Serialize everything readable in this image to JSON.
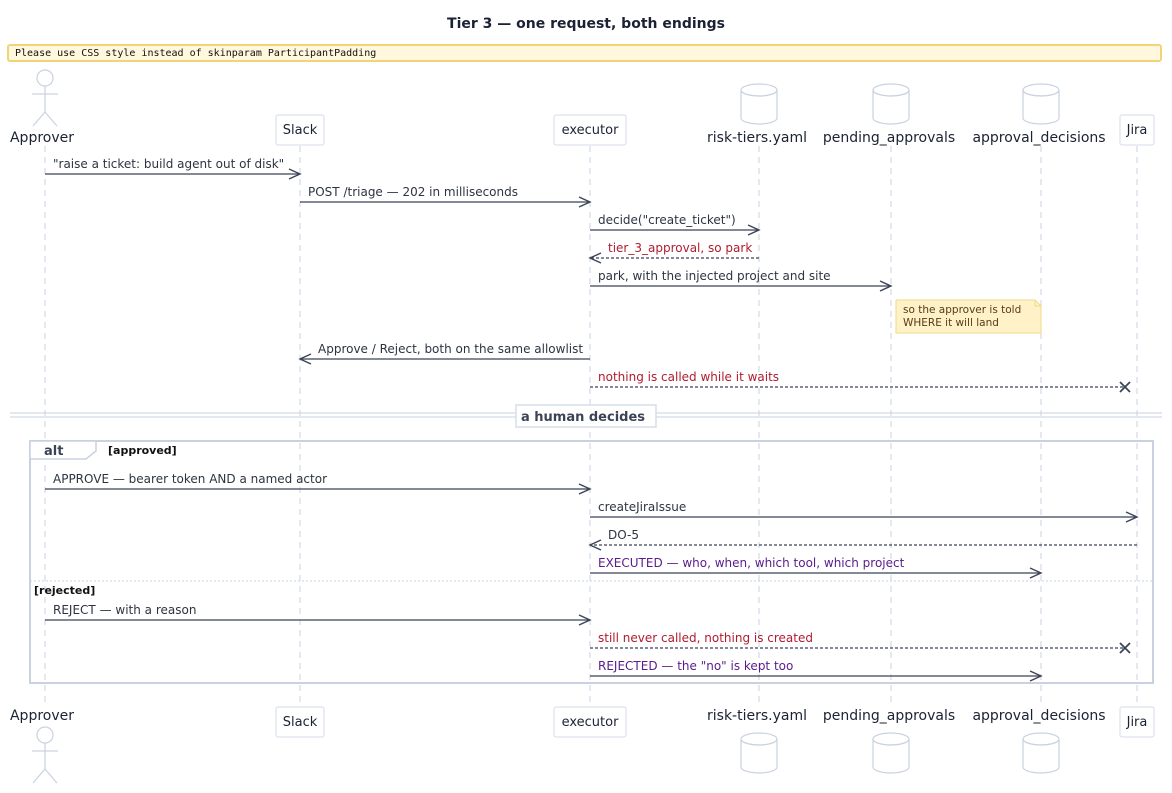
{
  "diagram": {
    "title": "Tier 3 — one request, both endings",
    "warning": "Please use CSS style instead of skinparam ParticipantPadding",
    "participants": [
      {
        "id": "approver",
        "label": "Approver",
        "kind": "actor"
      },
      {
        "id": "slack",
        "label": "Slack",
        "kind": "box"
      },
      {
        "id": "executor",
        "label": "executor",
        "kind": "box"
      },
      {
        "id": "risk",
        "label": "risk-tiers.yaml",
        "kind": "database"
      },
      {
        "id": "pending",
        "label": "pending_approvals",
        "kind": "database"
      },
      {
        "id": "decisions",
        "label": "approval_decisions",
        "kind": "database"
      },
      {
        "id": "jira",
        "label": "Jira",
        "kind": "box"
      }
    ],
    "messages": [
      {
        "from": "approver",
        "to": "slack",
        "label": "\"raise a ticket: build agent out of disk\"",
        "style": "solid",
        "color": "default"
      },
      {
        "from": "slack",
        "to": "executor",
        "label": "POST /triage — 202 in milliseconds",
        "style": "solid",
        "color": "default"
      },
      {
        "from": "executor",
        "to": "risk",
        "label": "decide(\"create_ticket\")",
        "style": "solid",
        "color": "default"
      },
      {
        "from": "risk",
        "to": "executor",
        "label": "tier_3_approval, so park",
        "style": "dashed",
        "color": "red"
      },
      {
        "from": "executor",
        "to": "pending",
        "label": "park, with the injected project and site",
        "style": "solid",
        "color": "default"
      },
      {
        "from": "executor",
        "to": "slack",
        "label": "Approve / Reject, both on the same allowlist",
        "style": "solid",
        "color": "default"
      },
      {
        "from": "executor",
        "to": "jira",
        "label": "nothing is called while it waits",
        "style": "lost",
        "color": "red"
      },
      {
        "from": "approver",
        "to": "executor",
        "label": "APPROVE — bearer token AND a named actor",
        "style": "solid",
        "color": "default"
      },
      {
        "from": "executor",
        "to": "jira",
        "label": "createJiraIssue",
        "style": "solid",
        "color": "default"
      },
      {
        "from": "jira",
        "to": "executor",
        "label": "DO-5",
        "style": "dashed",
        "color": "default"
      },
      {
        "from": "executor",
        "to": "decisions",
        "label": "EXECUTED — who, when, which tool, which project",
        "style": "solid",
        "color": "purple"
      },
      {
        "from": "approver",
        "to": "executor",
        "label": "REJECT — with a reason",
        "style": "solid",
        "color": "default"
      },
      {
        "from": "executor",
        "to": "jira",
        "label": "still never called, nothing is created",
        "style": "lost",
        "color": "red"
      },
      {
        "from": "executor",
        "to": "decisions",
        "label": "REJECTED — the \"no\" is kept too",
        "style": "solid",
        "color": "purple"
      }
    ],
    "note": {
      "line1": "so the approver is told",
      "line2": "WHERE it will land"
    },
    "divider": "a human decides",
    "alt": {
      "keyword": "alt",
      "guard_approved": "[approved]",
      "guard_rejected": "[rejected]"
    },
    "colors": {
      "arrow": "#3b4456",
      "red": "#b01c2e",
      "purple": "#5a1c8c",
      "note_bg": "#fff2c8",
      "warning_border": "#f3d37a",
      "frame": "#c9d2e0"
    }
  }
}
